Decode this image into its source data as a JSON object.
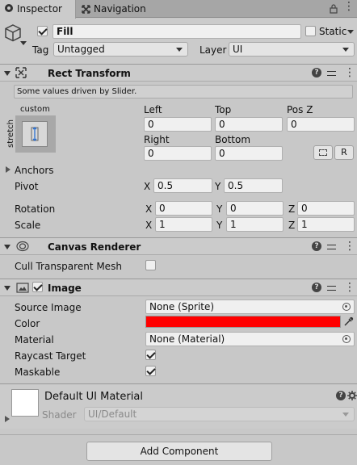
{
  "tabs": {
    "inspector": "Inspector",
    "navigation": "Navigation"
  },
  "object": {
    "name": "Fill",
    "static_label": "Static",
    "tag_label": "Tag",
    "tag_value": "Untagged",
    "layer_label": "Layer",
    "layer_value": "UI"
  },
  "rect_transform": {
    "title": "Rect Transform",
    "driven_note": "Some values driven by Slider.",
    "anchor_preset_top": "custom",
    "anchor_preset_side": "stretch",
    "labels": {
      "left": "Left",
      "top": "Top",
      "posz": "Pos Z",
      "right": "Right",
      "bottom": "Bottom"
    },
    "values": {
      "left": "0",
      "top": "0",
      "posz": "0",
      "right": "0",
      "bottom": "0"
    },
    "r_button": "R",
    "anchors_label": "Anchors",
    "pivot_label": "Pivot",
    "pivot": {
      "x": "0.5",
      "y": "0.5"
    },
    "rotation_label": "Rotation",
    "rotation": {
      "x": "0",
      "y": "0",
      "z": "0"
    },
    "scale_label": "Scale",
    "scale": {
      "x": "1",
      "y": "1",
      "z": "1"
    },
    "axis": {
      "x": "X",
      "y": "Y",
      "z": "Z"
    }
  },
  "canvas_renderer": {
    "title": "Canvas Renderer",
    "cull_label": "Cull Transparent Mesh"
  },
  "image": {
    "title": "Image",
    "source_label": "Source Image",
    "source_value": "None (Sprite)",
    "color_label": "Color",
    "color_value": "#ff0000",
    "material_label": "Material",
    "material_value": "None (Material)",
    "raycast_label": "Raycast Target",
    "maskable_label": "Maskable"
  },
  "material_preview": {
    "name": "Default UI Material",
    "shader_label": "Shader",
    "shader_value": "UI/Default"
  },
  "add_component": "Add Component"
}
